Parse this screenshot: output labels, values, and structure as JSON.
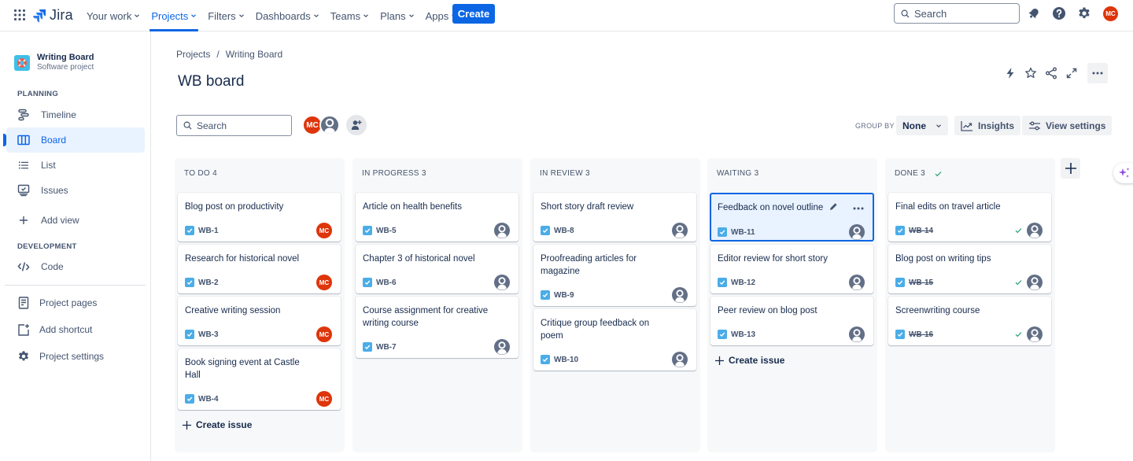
{
  "topnav": {
    "logo": "Jira",
    "items": [
      {
        "label": "Your work",
        "active": false
      },
      {
        "label": "Projects",
        "active": true
      },
      {
        "label": "Filters",
        "active": false
      },
      {
        "label": "Dashboards",
        "active": false
      },
      {
        "label": "Teams",
        "active": false
      },
      {
        "label": "Plans",
        "active": false
      },
      {
        "label": "Apps",
        "active": false
      }
    ],
    "create_label": "Create",
    "search_placeholder": "Search",
    "user_initials": "MC"
  },
  "sidebar": {
    "project_name": "Writing Board",
    "project_type": "Software project",
    "planning_heading": "PLANNING",
    "planning_items": [
      {
        "label": "Timeline",
        "icon": "timeline-icon"
      },
      {
        "label": "Board",
        "icon": "board-icon",
        "active": true
      },
      {
        "label": "List",
        "icon": "list-icon"
      },
      {
        "label": "Issues",
        "icon": "issues-icon"
      }
    ],
    "add_view": "Add view",
    "development_heading": "DEVELOPMENT",
    "code": "Code",
    "project_pages": "Project pages",
    "add_shortcut": "Add shortcut",
    "project_settings": "Project settings"
  },
  "header": {
    "breadcrumb": [
      "Projects",
      "Writing Board"
    ],
    "title": "WB board",
    "search_placeholder": "Search",
    "group_by_label": "GROUP BY",
    "group_by_value": "None",
    "insights": "Insights",
    "view_settings": "View settings",
    "people_initials": "MC"
  },
  "colors": {
    "accent": "#0c66e4",
    "avatar_red": "#de350b",
    "checkbox_blue": "#4bade8",
    "done_green": "#22a06b"
  },
  "columns": [
    {
      "title": "TO DO 4",
      "done": false,
      "create_issue": "Create issue",
      "cards": [
        {
          "title": "Blog post on productivity",
          "key": "WB-1",
          "assignee": "MC"
        },
        {
          "title": "Research for historical novel",
          "key": "WB-2",
          "assignee": "MC"
        },
        {
          "title": "Creative writing session",
          "key": "WB-3",
          "assignee": "MC"
        },
        {
          "title": "Book signing event at Castle Hall",
          "key": "WB-4",
          "assignee": "MC"
        }
      ]
    },
    {
      "title": "IN PROGRESS 3",
      "done": false,
      "cards": [
        {
          "title": "Article on health benefits",
          "key": "WB-5",
          "assignee": ""
        },
        {
          "title": "Chapter 3 of historical novel",
          "key": "WB-6",
          "assignee": ""
        },
        {
          "title": "Course assignment for creative writing course",
          "key": "WB-7",
          "assignee": ""
        }
      ]
    },
    {
      "title": "IN REVIEW 3",
      "done": false,
      "cards": [
        {
          "title": "Short story draft review",
          "key": "WB-8",
          "assignee": ""
        },
        {
          "title": "Proofreading articles for magazine",
          "key": "WB-9",
          "assignee": ""
        },
        {
          "title": "Critique group feedback on poem",
          "key": "WB-10",
          "assignee": ""
        }
      ]
    },
    {
      "title": "WAITING 3",
      "done": false,
      "create_issue": "Create issue",
      "cards": [
        {
          "title": "Feedback on novel outline",
          "key": "WB-11",
          "assignee": "",
          "selected": true
        },
        {
          "title": "Editor review for short story",
          "key": "WB-12",
          "assignee": ""
        },
        {
          "title": "Peer review on blog post",
          "key": "WB-13",
          "assignee": ""
        }
      ]
    },
    {
      "title": "DONE 3",
      "done": true,
      "cards": [
        {
          "title": "Final edits on travel article",
          "key": "WB-14",
          "assignee": "",
          "resolved": true
        },
        {
          "title": "Blog post on writing tips",
          "key": "WB-15",
          "assignee": "",
          "resolved": true
        },
        {
          "title": "Screenwriting course",
          "key": "WB-16",
          "assignee": "",
          "resolved": true
        }
      ]
    }
  ]
}
